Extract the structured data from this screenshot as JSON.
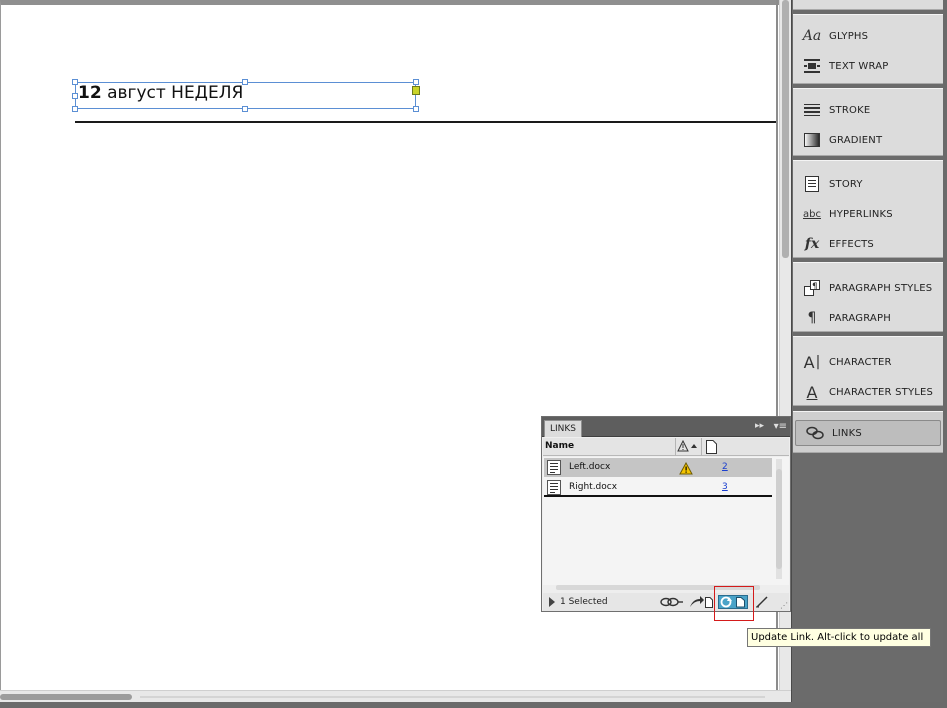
{
  "document": {
    "frame_text_number": "12",
    "frame_text_rest": " август НЕДЕЛЯ"
  },
  "dock": {
    "groups": [
      {
        "items": [
          {
            "label": "GLYPHS",
            "icon": "glyphs-icon"
          },
          {
            "label": "TEXT WRAP",
            "icon": "text-wrap-icon"
          }
        ]
      },
      {
        "items": [
          {
            "label": "STROKE",
            "icon": "stroke-icon"
          },
          {
            "label": "GRADIENT",
            "icon": "gradient-icon"
          }
        ]
      },
      {
        "items": [
          {
            "label": "STORY",
            "icon": "story-icon"
          },
          {
            "label": "HYPERLINKS",
            "icon": "hyperlinks-icon"
          },
          {
            "label": "EFFECTS",
            "icon": "effects-icon"
          }
        ]
      },
      {
        "items": [
          {
            "label": "PARAGRAPH STYLES",
            "icon": "paragraph-styles-icon"
          },
          {
            "label": "PARAGRAPH",
            "icon": "paragraph-icon"
          }
        ]
      },
      {
        "items": [
          {
            "label": "CHARACTER",
            "icon": "character-icon"
          },
          {
            "label": "CHARACTER STYLES",
            "icon": "character-styles-icon"
          }
        ]
      },
      {
        "items": [
          {
            "label": "LINKS",
            "icon": "links-icon"
          }
        ]
      }
    ]
  },
  "links_panel": {
    "tab_label": "LINKS",
    "column_name": "Name",
    "rows": [
      {
        "name": "Left.docx",
        "page": "2",
        "warning": true
      },
      {
        "name": "Right.docx",
        "page": "3",
        "warning": false
      }
    ],
    "status": "1 Selected"
  },
  "tooltip": {
    "text": "Update Link. Alt-click to update all"
  },
  "colors": {
    "selection": "#5b8fd4",
    "highlight": "#d41a1a",
    "tooltip_bg": "#ffffe1"
  }
}
